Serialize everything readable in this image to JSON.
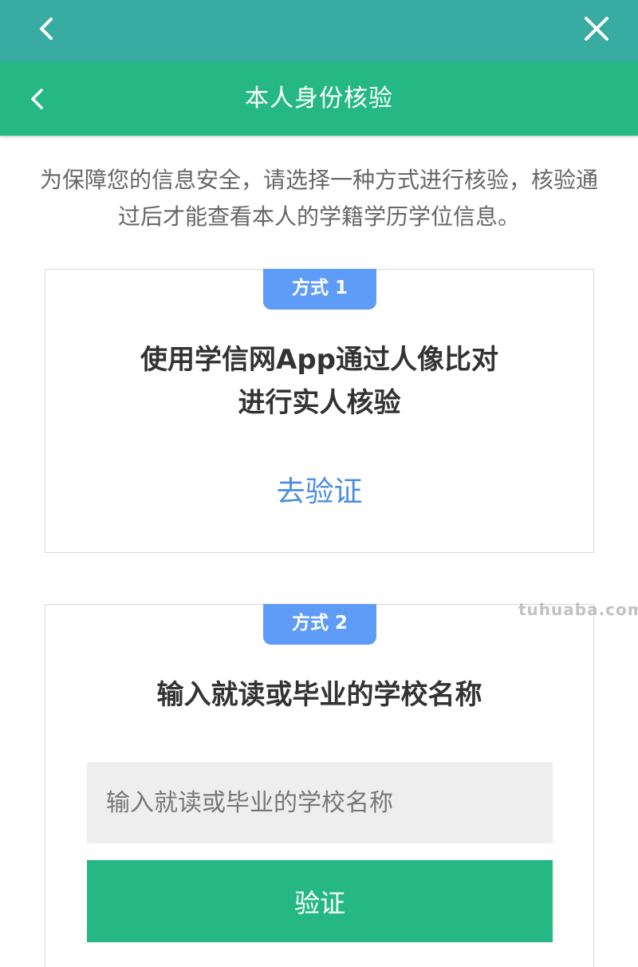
{
  "colors": {
    "top_bar": "#38aba3",
    "title_bar": "#26b884",
    "badge": "#5f9cf7",
    "link": "#4a8ee0",
    "button": "#26b884"
  },
  "top_bar": {
    "back_icon": "chevron-left-icon",
    "close_icon": "close-icon"
  },
  "header": {
    "back_icon": "chevron-left-icon",
    "title": "本人身份核验"
  },
  "intro": {
    "text": "为保障您的信息安全，请选择一种方式进行核验，核验通过后才能查看本人的学籍学历学位信息。"
  },
  "method1": {
    "badge": "方式 1",
    "heading_line1": "使用学信网App通过人像比对",
    "heading_line2": "进行实人核验",
    "link": "去验证"
  },
  "method2": {
    "badge": "方式 2",
    "heading": "输入就读或毕业的学校名称",
    "input_placeholder": "输入就读或毕业的学校名称",
    "input_value": "",
    "button": "验证"
  },
  "watermark": "tuhuaba.com"
}
